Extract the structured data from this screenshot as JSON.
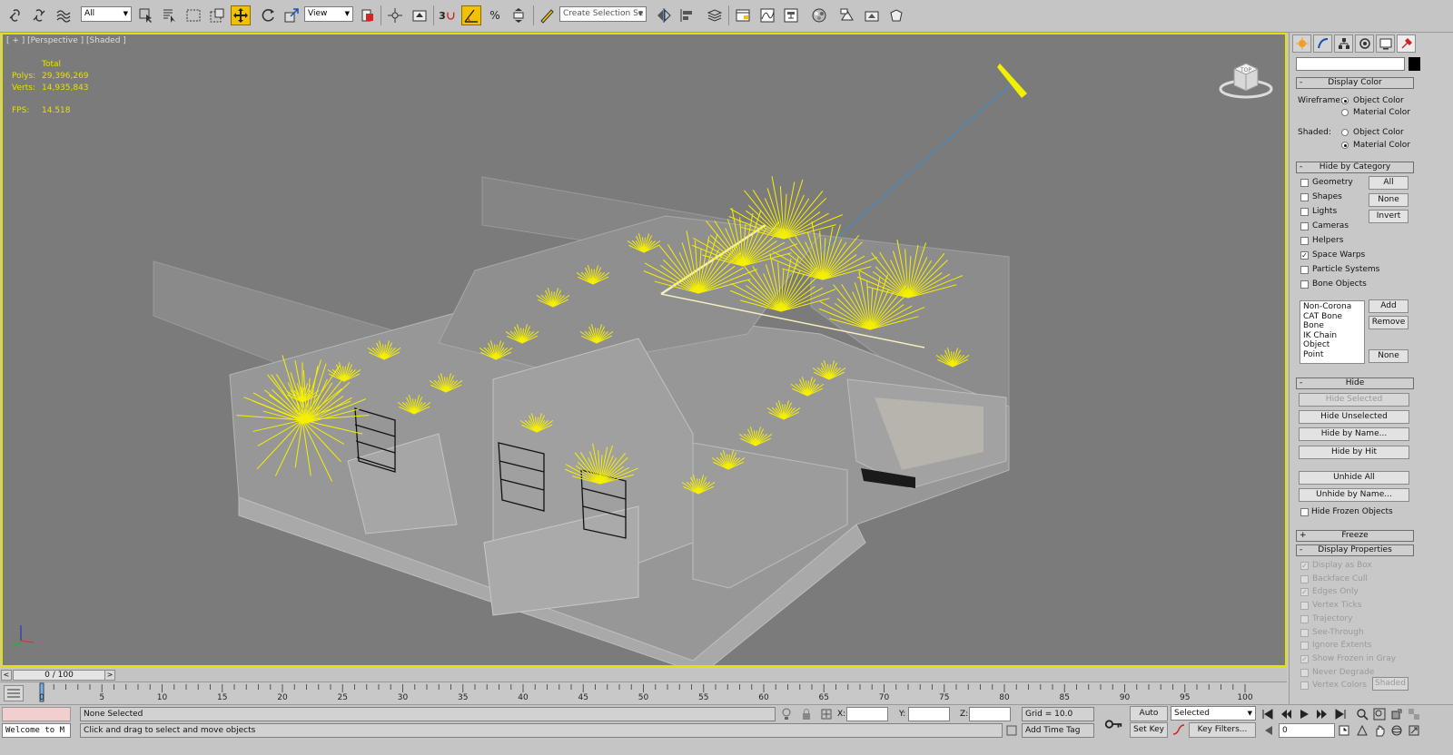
{
  "toolbar": {
    "selection_filter": "All",
    "reference_coord": "View",
    "snap_label": "3",
    "percent_label": "%",
    "named_selection_placeholder": "Create Selection Se"
  },
  "viewport": {
    "label": "[ + ] [Perspective ] [Shaded ]",
    "stats_header": "Total",
    "polys_label": "Polys:",
    "polys_value": "29,396,269",
    "verts_label": "Verts:",
    "verts_value": "14,935,843",
    "fps_label": "FPS:",
    "fps_value": "14.518",
    "viewcube_label": "TOP"
  },
  "command_panel": {
    "display_color": {
      "title": "Display Color",
      "wireframe_label": "Wireframe:",
      "shaded_label": "Shaded:",
      "object_color": "Object Color",
      "material_color": "Material Color"
    },
    "hide_by_category": {
      "title": "Hide by Category",
      "items": [
        {
          "label": "Geometry",
          "checked": false
        },
        {
          "label": "Shapes",
          "checked": false
        },
        {
          "label": "Lights",
          "checked": false
        },
        {
          "label": "Cameras",
          "checked": false
        },
        {
          "label": "Helpers",
          "checked": false
        },
        {
          "label": "Space Warps",
          "checked": true
        },
        {
          "label": "Particle Systems",
          "checked": false
        },
        {
          "label": "Bone Objects",
          "checked": false
        }
      ],
      "btn_all": "All",
      "btn_none": "None",
      "btn_invert": "Invert",
      "list": [
        "Non-Corona",
        "CAT Bone",
        "Bone",
        "IK Chain Object",
        "Point"
      ],
      "btn_add": "Add",
      "btn_remove": "Remove",
      "btn_none2": "None"
    },
    "hide": {
      "title": "Hide",
      "hide_selected": "Hide Selected",
      "hide_unselected": "Hide Unselected",
      "hide_by_name": "Hide by Name...",
      "hide_by_hit": "Hide by Hit",
      "unhide_all": "Unhide All",
      "unhide_by_name": "Unhide by Name...",
      "hide_frozen": "Hide Frozen Objects"
    },
    "freeze": {
      "title": "Freeze"
    },
    "display_properties": {
      "title": "Display Properties",
      "items": [
        {
          "label": "Display as Box",
          "checked": true
        },
        {
          "label": "Backface Cull",
          "checked": false
        },
        {
          "label": "Edges Only",
          "checked": true
        },
        {
          "label": "Vertex Ticks",
          "checked": false
        },
        {
          "label": "Trajectory",
          "checked": false
        },
        {
          "label": "See-Through",
          "checked": false
        },
        {
          "label": "Ignore Extents",
          "checked": false
        },
        {
          "label": "Show Frozen in Gray",
          "checked": true
        },
        {
          "label": "Never Degrade",
          "checked": false
        },
        {
          "label": "Vertex Colors",
          "checked": false
        }
      ],
      "shaded_btn": "Shaded"
    }
  },
  "time_slider": {
    "position": "0 / 100",
    "left_arrow": "<",
    "right_arrow": ">",
    "ticks": [
      "0",
      "5",
      "10",
      "15",
      "20",
      "25",
      "30",
      "35",
      "40",
      "45",
      "50",
      "55",
      "60",
      "65",
      "70",
      "75",
      "80",
      "85",
      "90",
      "95",
      "100"
    ]
  },
  "status_bar": {
    "maxscript_text": "Welcome to M",
    "selection_status": "None Selected",
    "prompt": "Click and drag to select and move objects",
    "x_label": "X:",
    "y_label": "Y:",
    "z_label": "Z:",
    "grid": "Grid = 10.0",
    "add_time_tag": "Add Time Tag",
    "auto_key": "Auto Key",
    "set_key": "Set Key",
    "key_mode": "Selected",
    "key_filters": "Key Filters...",
    "frame": "0"
  }
}
